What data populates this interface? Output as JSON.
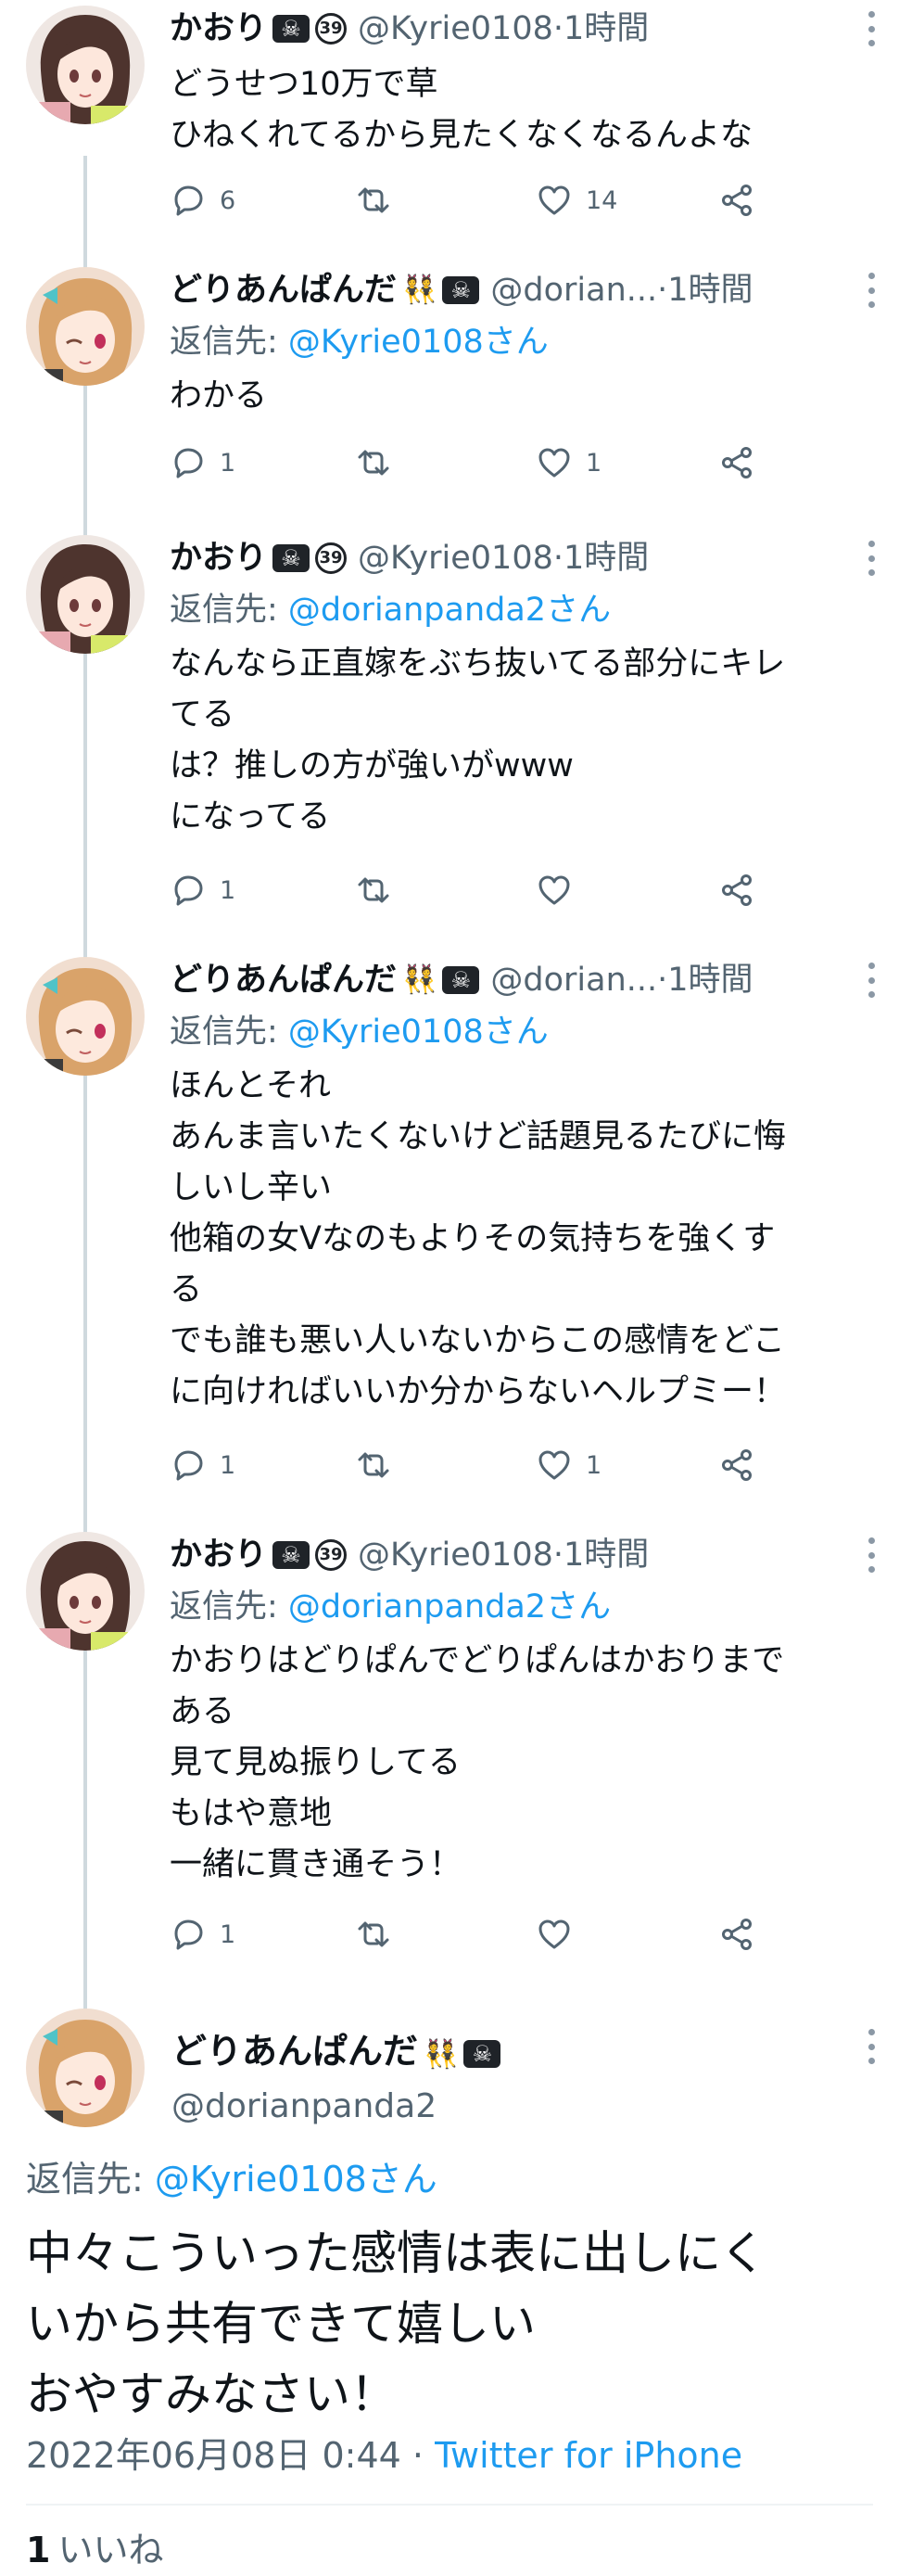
{
  "users": {
    "kaori": {
      "name": "かおり",
      "handle": "@Kyrie0108"
    },
    "dori": {
      "name": "どりあんぱんだ",
      "handle": "@dorian...",
      "full_handle": "@dorianpanda2"
    }
  },
  "badges": {
    "pirate": "☠",
    "age": "39",
    "twins": "👯"
  },
  "separator": " · ",
  "tweets": [
    {
      "time": "1時間",
      "lines": [
        "どうせつ10万で草",
        "ひねくれてるから見たくなくなるんよな"
      ],
      "replies": "6",
      "retweets": "",
      "likes": "14"
    },
    {
      "time": "1時間",
      "reply_label": "返信先: ",
      "reply_target": "@Kyrie0108さん",
      "lines": [
        "わかる"
      ],
      "replies": "1",
      "retweets": "",
      "likes": "1"
    },
    {
      "time": "1時間",
      "reply_label": "返信先: ",
      "reply_target": "@dorianpanda2さん",
      "lines": [
        "なんなら正直嫁をぶち抜いてる部分にキレ",
        "てる",
        "は？推しの方が強いがwww",
        "になってる"
      ],
      "replies": "1",
      "retweets": "",
      "likes": ""
    },
    {
      "time": "1時間",
      "reply_label": "返信先: ",
      "reply_target": "@Kyrie0108さん",
      "lines": [
        "ほんとそれ",
        "あんま言いたくないけど話題見るたびに悔",
        "しいし辛い",
        "他箱の女Vなのもよりその気持ちを強くす",
        "る",
        "でも誰も悪い人いないからこの感情をどこ",
        "に向ければいいか分からないヘルプミー！"
      ],
      "replies": "1",
      "retweets": "",
      "likes": "1"
    },
    {
      "time": "1時間",
      "reply_label": "返信先: ",
      "reply_target": "@dorianpanda2さん",
      "lines": [
        "かおりはどりぱんでどりぱんはかおりまで",
        "ある",
        "見て見ぬ振りしてる",
        "もはや意地",
        "一緒に貫き通そう！"
      ],
      "replies": "1",
      "retweets": "",
      "likes": ""
    }
  ],
  "main_tweet": {
    "reply_label": "返信先: ",
    "reply_target": "@Kyrie0108さん",
    "lines": [
      "中々こういった感情は表に出しにく",
      "いから共有できて嬉しい",
      "おやすみなさい！"
    ],
    "date": "2022年06月08日 0:44",
    "source": "Twitter for iPhone",
    "likes_count": "1",
    "likes_label": "いいね"
  },
  "icons": [
    "reply-icon",
    "retweet-icon",
    "like-icon",
    "share-icon",
    "more-icon"
  ],
  "colors": {
    "link": "#1d9bf0",
    "secondary": "#536471",
    "thread_line": "#cfd9de",
    "text": "#0f1419"
  }
}
